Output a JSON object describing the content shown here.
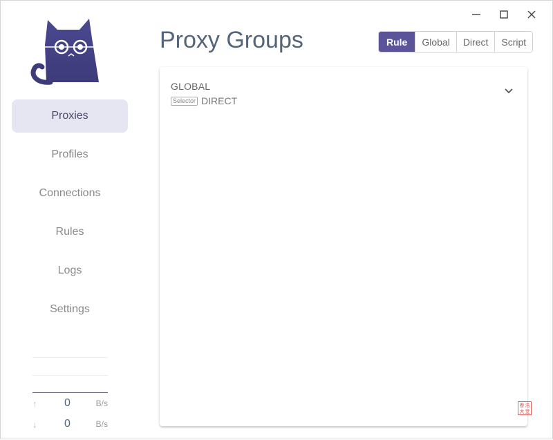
{
  "window": {
    "controls": [
      "minimize",
      "maximize",
      "close"
    ]
  },
  "sidebar": {
    "logo": "cat-logo",
    "items": [
      {
        "label": "Proxies",
        "active": true
      },
      {
        "label": "Profiles",
        "active": false
      },
      {
        "label": "Connections",
        "active": false
      },
      {
        "label": "Rules",
        "active": false
      },
      {
        "label": "Logs",
        "active": false
      },
      {
        "label": "Settings",
        "active": false
      }
    ],
    "traffic": {
      "upload": {
        "icon": "arrow-up-icon",
        "value": "0",
        "unit": "B/s"
      },
      "download": {
        "icon": "arrow-down-icon",
        "value": "0",
        "unit": "B/s"
      }
    }
  },
  "main": {
    "title": "Proxy Groups",
    "modes": [
      {
        "label": "Rule",
        "active": true
      },
      {
        "label": "Global",
        "active": false
      },
      {
        "label": "Direct",
        "active": false
      },
      {
        "label": "Script",
        "active": false
      }
    ],
    "groups": [
      {
        "name": "GLOBAL",
        "type": "Selector",
        "now": "DIRECT"
      }
    ],
    "seal_chars": [
      "春",
      "浩",
      "大",
      "觉"
    ]
  },
  "colors": {
    "accent": "#5b5499",
    "nav_active_bg": "#e6e5f2",
    "title": "#54657a",
    "seal": "#e35a5a"
  }
}
